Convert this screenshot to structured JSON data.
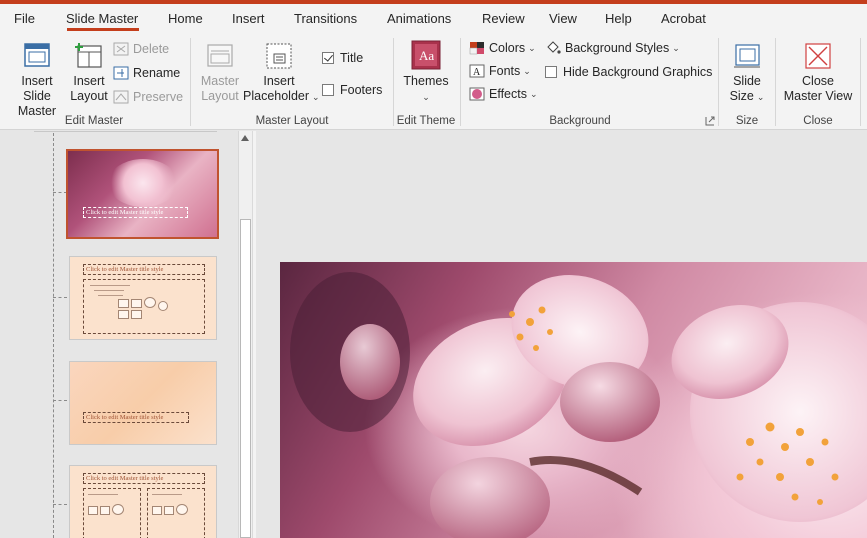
{
  "tabs": [
    {
      "label": "File"
    },
    {
      "label": "Slide Master"
    },
    {
      "label": "Home"
    },
    {
      "label": "Insert"
    },
    {
      "label": "Transitions"
    },
    {
      "label": "Animations"
    },
    {
      "label": "Review"
    },
    {
      "label": "View"
    },
    {
      "label": "Help"
    },
    {
      "label": "Acrobat"
    }
  ],
  "active_tab": "Slide Master",
  "ribbon": {
    "edit_master": {
      "label": "Edit Master",
      "insert_slide_master": {
        "line1": "Insert Slide",
        "line2": "Master"
      },
      "insert_layout": {
        "line1": "Insert",
        "line2": "Layout"
      },
      "delete": "Delete",
      "rename": "Rename",
      "preserve": "Preserve"
    },
    "master_layout": {
      "label": "Master Layout",
      "master_layout_btn": {
        "line1": "Master",
        "line2": "Layout"
      },
      "insert_placeholder": {
        "line1": "Insert",
        "line2": "Placeholder"
      },
      "title": "Title",
      "title_checked": true,
      "footers": "Footers",
      "footers_checked": false
    },
    "edit_theme": {
      "label": "Edit Theme",
      "themes": "Themes"
    },
    "background": {
      "label": "Background",
      "colors": "Colors",
      "fonts": "Fonts",
      "effects": "Effects",
      "background_styles": "Background Styles",
      "hide_background_graphics": "Hide Background Graphics",
      "hide_checked": false
    },
    "size": {
      "label": "Size",
      "slide_size": {
        "line1": "Slide",
        "line2": "Size"
      }
    },
    "close": {
      "label": "Close",
      "close_master_view": {
        "line1": "Close",
        "line2": "Master View"
      }
    }
  },
  "thumbnails": {
    "master_title": "Click to edit Master title style",
    "layout1_title": "Click to edit Master title style",
    "layout1_subtitle": "Click to edit Master text styles",
    "layout2_title": "Click to edit Master title style",
    "layout3_title": "Click to edit Master title style"
  },
  "colors": {
    "accent": "#c43e1c",
    "ribbon_bg": "#f3f3f3",
    "pane_bg": "#e6e6e6"
  }
}
